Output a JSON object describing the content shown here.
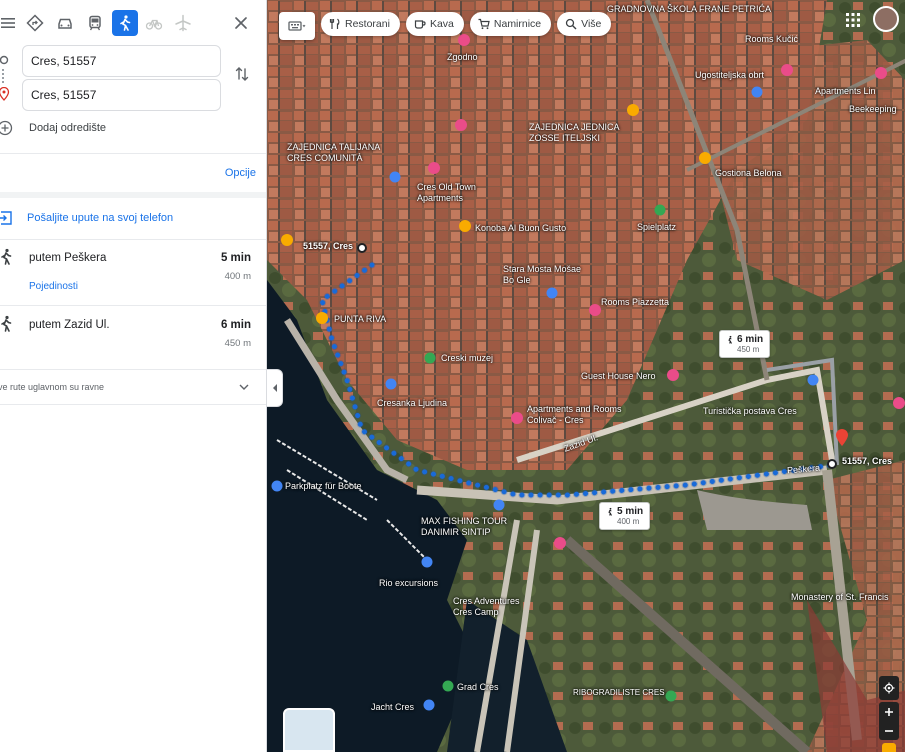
{
  "panel": {
    "modes": [
      {
        "name": "best-route-icon"
      },
      {
        "name": "car-icon"
      },
      {
        "name": "transit-icon"
      },
      {
        "name": "walking-icon",
        "active": true
      },
      {
        "name": "bicycle-icon",
        "dim": true
      },
      {
        "name": "flight-icon",
        "dim": true
      }
    ],
    "origin": "Cres, 51557",
    "destination": "Cres, 51557",
    "add_destination": "Dodaj odredište",
    "options": "Opcije",
    "send_to_phone": "Pošaljite upute na svoj telefon",
    "routes": [
      {
        "name": "putem Peškera",
        "time": "5 min",
        "distance": "400 m",
        "details": "Pojedinosti"
      },
      {
        "name": "putem Zazid Ul.",
        "time": "6 min",
        "distance": "450 m"
      }
    ],
    "route_note": "ve rute uglavnom su ravne"
  },
  "map": {
    "chips": [
      {
        "label": "Restorani",
        "icon": "fork-knife-icon"
      },
      {
        "label": "Kava",
        "icon": "coffee-icon"
      },
      {
        "label": "Namirnice",
        "icon": "cart-icon"
      },
      {
        "label": "Više",
        "icon": "search-icon"
      }
    ],
    "route_tips": [
      {
        "time": "6 min",
        "distance": "450 m"
      },
      {
        "time": "5 min",
        "distance": "400 m"
      }
    ],
    "labels": [
      "GRADNOVNA ŠKOLA FRANE PETRIĆA",
      "Zgodno",
      "Rooms Kučić",
      "Ugostiteljska obrt",
      "Apartments Lin",
      "Beekeeping",
      "ZAJEDNICA TALIJANA CRES COMUNITÀ",
      "ZAJEDNICA JEDNICA ZOSSE ITELJSKI",
      "Cres Old Town Apartments",
      "Gostiona Belona",
      "Spielplatz",
      "Konoba Al Buon Gusto",
      "Stara Mosta Mošae Bo Gle",
      "51557, Cres",
      "Rooms Piazzetta",
      "PUNTA RIVA",
      "Creski muzej",
      "Guest House Nero",
      "Cresanka Ljudina",
      "Apartments and Rooms Colivač - Cres",
      "Zazid Ul.",
      "Turistička postava Cres",
      "Peškera",
      "51557, Cres",
      "Parkplatz für Boote",
      "MAX FISHING TOUR DANIMIR SINTIP",
      "Rio excursions",
      "Cres Adventures Cres Camp",
      "Grad Cres",
      "Monastery of St. Francis",
      "Jacht Cres",
      "RIBOGRADILISTE CRES"
    ]
  }
}
